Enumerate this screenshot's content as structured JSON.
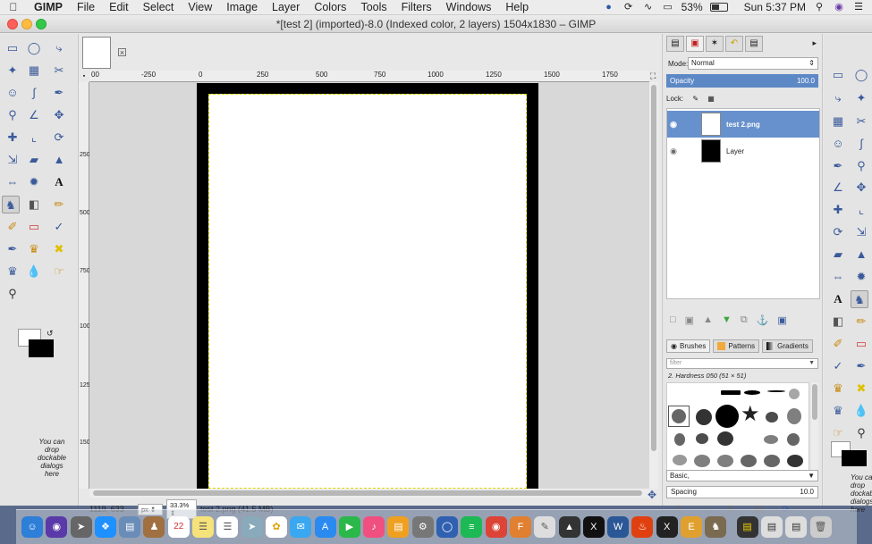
{
  "menubar": {
    "app": "GIMP",
    "items": [
      "File",
      "Edit",
      "Select",
      "View",
      "Image",
      "Layer",
      "Colors",
      "Tools",
      "Filters",
      "Windows",
      "Help"
    ],
    "battery_percent": "53%",
    "battery_level": 0.53,
    "clock": "Sun 5:37 PM"
  },
  "window": {
    "title": "*[test 2] (imported)-8.0 (Indexed color, 2 layers) 1504x1830 – GIMP"
  },
  "ruler": {
    "top_labels": [
      "-250",
      "0",
      "250",
      "500",
      "750",
      "1000",
      "1250",
      "1500",
      "1750"
    ],
    "top_partial": "00",
    "left_labels": [
      "250",
      "500",
      "750",
      "1000",
      "1250",
      "1500"
    ]
  },
  "status": {
    "coords": "1119, 633",
    "unit": "px",
    "zoom": "33.3%",
    "info": "test 2.png (41.5 MB)"
  },
  "toolbox": {
    "drop_note": "You can drop dockable dialogs here"
  },
  "layers": {
    "mode_label": "Mode:",
    "mode_value": "Normal",
    "opacity_label": "Opacity",
    "opacity_value": "100.0",
    "lock_label": "Lock:",
    "items": [
      {
        "name": "test 2.png",
        "selected": true
      },
      {
        "name": "Layer",
        "selected": false
      }
    ]
  },
  "brushes": {
    "tabs": [
      "Brushes",
      "Patterns",
      "Gradients"
    ],
    "filter_placeholder": "filter",
    "selected_brush": "2. Hardness 050 (51 × 51)",
    "tag": "Basic,",
    "spacing_label": "Spacing",
    "spacing_value": "10.0"
  },
  "colors": {
    "accent": "#5c88c6",
    "selection": "#6791cc"
  }
}
